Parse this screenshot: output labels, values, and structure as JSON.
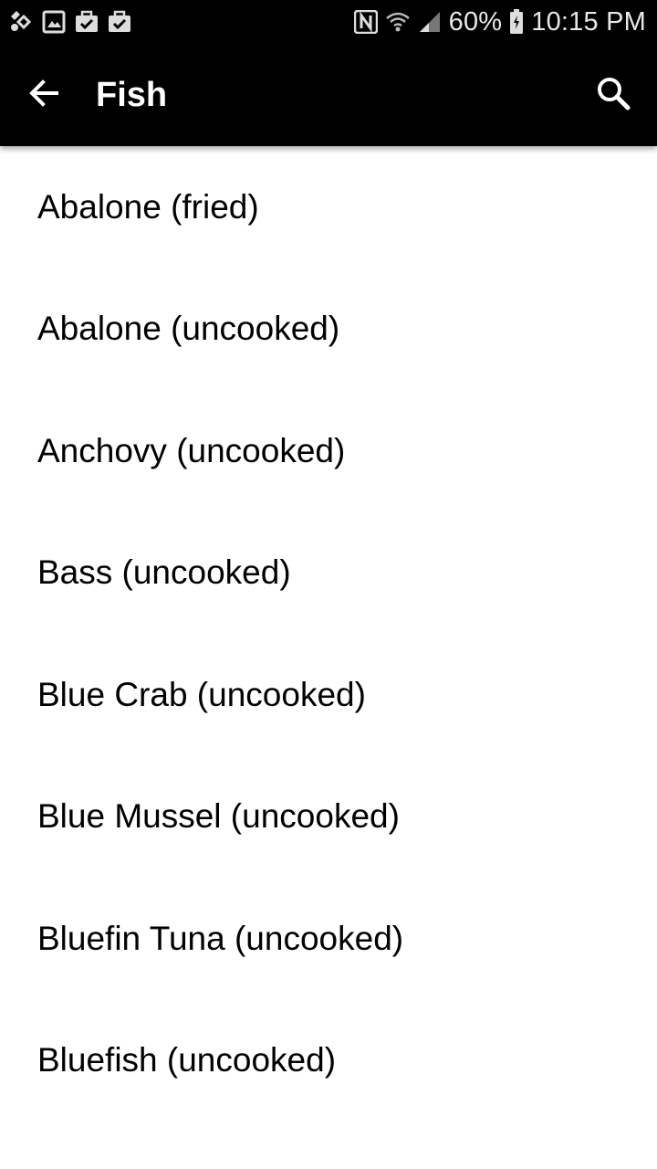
{
  "status_bar": {
    "battery": "60%",
    "time": "10:15 PM",
    "icons_left": [
      "notification-icon",
      "image-icon",
      "briefcase-check-icon",
      "briefcase-check-icon"
    ],
    "icons_right": [
      "nfc-icon",
      "wifi-icon",
      "signal-icon",
      "battery-icon"
    ]
  },
  "toolbar": {
    "title": "Fish",
    "back_icon": "arrow-back-icon",
    "search_icon": "search-icon"
  },
  "items": [
    {
      "label": "Abalone (fried)"
    },
    {
      "label": "Abalone (uncooked)"
    },
    {
      "label": "Anchovy (uncooked)"
    },
    {
      "label": "Bass (uncooked)"
    },
    {
      "label": "Blue Crab (uncooked)"
    },
    {
      "label": "Blue Mussel (uncooked)"
    },
    {
      "label": "Bluefin Tuna (uncooked)"
    },
    {
      "label": "Bluefish (uncooked)"
    }
  ],
  "colors": {
    "appbar": "#000000",
    "background": "#ffffff",
    "text": "#000000"
  }
}
